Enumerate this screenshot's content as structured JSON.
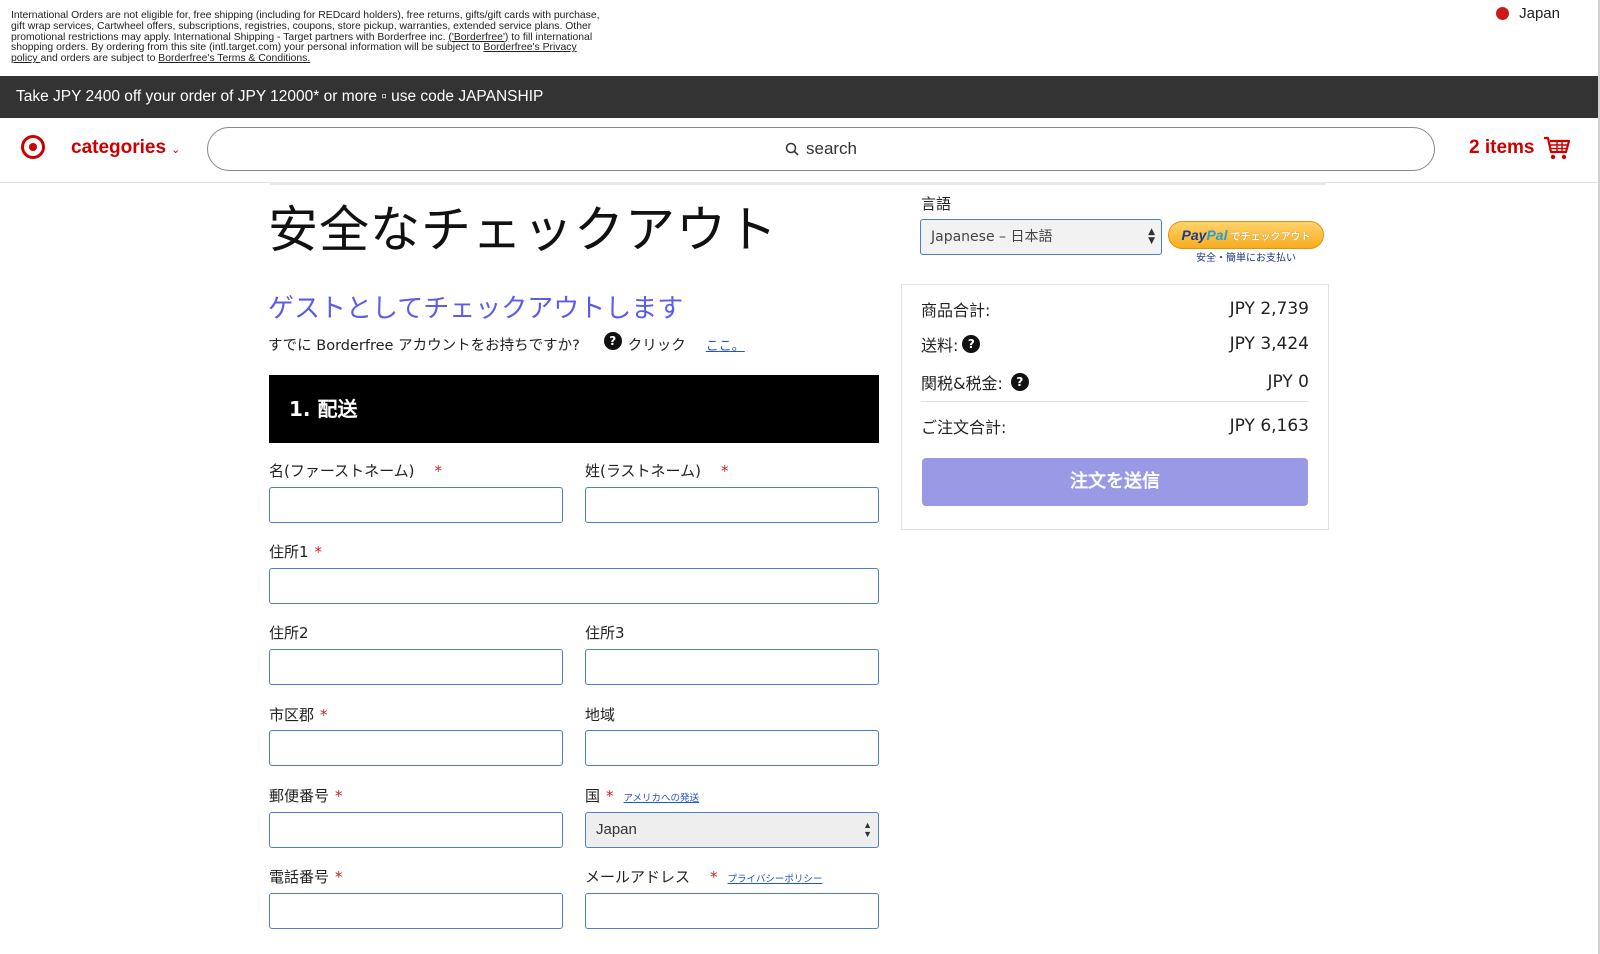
{
  "notice": {
    "text1": "International Orders are not eligible for, free shipping (including for REDcard holders), free returns, gifts/gift cards with purchase, gift wrap services, Cartwheel offers, subscriptions, registries, coupons, store pickup, warranties, extended service plans. Other promotional restrictions may apply. International Shipping - Target partners with Borderfree inc.",
    "borderfree_link": "('Borderfree')",
    "text2": " to fill international shopping orders. By ordering from this site (intl.target.com) your personal information will be subject to ",
    "privacy_link": "Borderfree's Privacy policy ",
    "text3": "and orders are subject to ",
    "terms_link": "Borderfree's Terms & Conditions."
  },
  "country": {
    "label": "Japan",
    "color": "#cc1a1a"
  },
  "promo": {
    "text": "Take JPY 2400 off your order of JPY 12000* or more ▫ use code JAPANSHIP"
  },
  "header": {
    "logo_icon": "target-bullseye-icon",
    "categories_label": "categories",
    "search_placeholder": "search",
    "cart_count_label": "2 items",
    "brand_color": "#cc0000"
  },
  "checkout": {
    "title": "安全なチェックアウト",
    "guest_heading": "ゲストとしてチェックアウトします",
    "have_account": "すでに Borderfree アカウントをお持ちですか?",
    "help_mark": "?",
    "click_label": "クリック",
    "here_link": "ここ。",
    "section_title": "1. 配送"
  },
  "form": {
    "first_name": "名(ファーストネーム)",
    "last_name": "姓(ラストネーム)",
    "address1": "住所1",
    "address2": "住所2",
    "address3": "住所3",
    "city": "市区郡",
    "region": "地域",
    "postal": "郵便番号",
    "country": "国",
    "us_shipping_link": "アメリカへの発送",
    "country_value": "Japan",
    "phone": "電話番号",
    "email": "メールアドレス",
    "privacy_link": "プライバシーポリシー",
    "required_mark": "*"
  },
  "language": {
    "label": "言語",
    "selected": "Japanese – 日本語"
  },
  "paypal": {
    "pay": "Pay",
    "pal": "Pal",
    "checkout": "でチェックアウト",
    "subtitle": "安全・簡単にお支払い"
  },
  "summary": {
    "subtotal_label": "商品合計:",
    "subtotal_value": "JPY 2,739",
    "shipping_label": "送料:",
    "shipping_value": "JPY 3,424",
    "duties_label": "関税&税金:",
    "duties_value": "JPY 0",
    "total_label": "ご注文合計:",
    "total_value": "JPY 6,163",
    "submit_label": "注文を送信",
    "submit_color": "#9999e6"
  }
}
